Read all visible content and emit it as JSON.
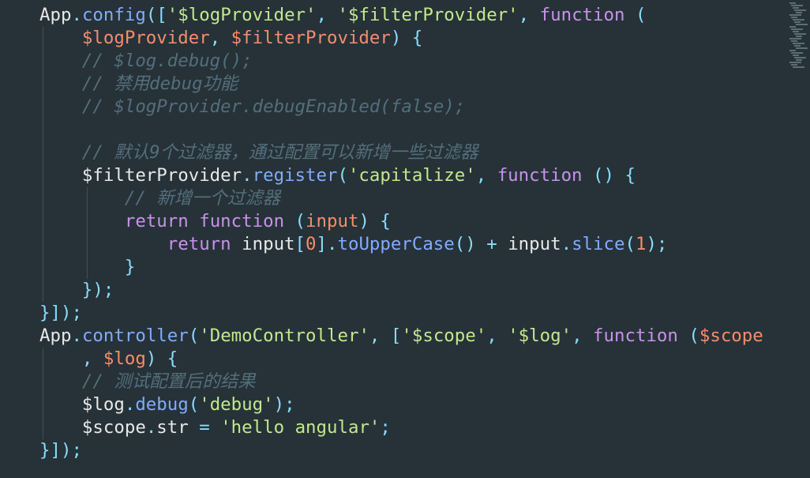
{
  "code": {
    "lines": [
      [
        {
          "t": "App",
          "c": "id"
        },
        {
          "t": ".",
          "c": "punc"
        },
        {
          "t": "config",
          "c": "prop"
        },
        {
          "t": "([",
          "c": "punc"
        },
        {
          "t": "'$logProvider'",
          "c": "str"
        },
        {
          "t": ", ",
          "c": "punc"
        },
        {
          "t": "'$filterProvider'",
          "c": "str"
        },
        {
          "t": ", ",
          "c": "punc"
        },
        {
          "t": "function",
          "c": "kw"
        },
        {
          "t": " (",
          "c": "punc"
        }
      ],
      [
        {
          "t": "    ",
          "c": "id"
        },
        {
          "t": "$logProvider",
          "c": "var"
        },
        {
          "t": ", ",
          "c": "punc"
        },
        {
          "t": "$filterProvider",
          "c": "var"
        },
        {
          "t": ") {",
          "c": "punc"
        }
      ],
      [
        {
          "t": "    ",
          "c": "id"
        },
        {
          "t": "// $log.debug();",
          "c": "com"
        }
      ],
      [
        {
          "t": "    ",
          "c": "id"
        },
        {
          "t": "// 禁用debug功能",
          "c": "com"
        }
      ],
      [
        {
          "t": "    ",
          "c": "id"
        },
        {
          "t": "// $logProvider.debugEnabled(false);",
          "c": "com"
        }
      ],
      [
        {
          "t": "",
          "c": "id"
        }
      ],
      [
        {
          "t": "    ",
          "c": "id"
        },
        {
          "t": "// 默认9个过滤器，通过配置可以新增一些过滤器",
          "c": "com"
        }
      ],
      [
        {
          "t": "    ",
          "c": "id"
        },
        {
          "t": "$filterProvider",
          "c": "id"
        },
        {
          "t": ".",
          "c": "punc"
        },
        {
          "t": "register",
          "c": "prop"
        },
        {
          "t": "(",
          "c": "punc"
        },
        {
          "t": "'capitalize'",
          "c": "str"
        },
        {
          "t": ", ",
          "c": "punc"
        },
        {
          "t": "function",
          "c": "kw"
        },
        {
          "t": " () {",
          "c": "punc"
        }
      ],
      [
        {
          "t": "        ",
          "c": "id"
        },
        {
          "t": "// 新增一个过滤器",
          "c": "com"
        }
      ],
      [
        {
          "t": "        ",
          "c": "id"
        },
        {
          "t": "return",
          "c": "kw"
        },
        {
          "t": " ",
          "c": "id"
        },
        {
          "t": "function",
          "c": "kw"
        },
        {
          "t": " (",
          "c": "punc"
        },
        {
          "t": "input",
          "c": "var"
        },
        {
          "t": ") {",
          "c": "punc"
        }
      ],
      [
        {
          "t": "            ",
          "c": "id"
        },
        {
          "t": "return",
          "c": "kw"
        },
        {
          "t": " input",
          "c": "id"
        },
        {
          "t": "[",
          "c": "punc"
        },
        {
          "t": "0",
          "c": "num"
        },
        {
          "t": "].",
          "c": "punc"
        },
        {
          "t": "toUpperCase",
          "c": "prop"
        },
        {
          "t": "() + ",
          "c": "punc"
        },
        {
          "t": "input",
          "c": "id"
        },
        {
          "t": ".",
          "c": "punc"
        },
        {
          "t": "slice",
          "c": "prop"
        },
        {
          "t": "(",
          "c": "punc"
        },
        {
          "t": "1",
          "c": "num"
        },
        {
          "t": ");",
          "c": "punc"
        }
      ],
      [
        {
          "t": "        ",
          "c": "id"
        },
        {
          "t": "}",
          "c": "punc"
        }
      ],
      [
        {
          "t": "    ",
          "c": "id"
        },
        {
          "t": "});",
          "c": "punc"
        }
      ],
      [
        {
          "t": "}]);",
          "c": "punc"
        }
      ],
      [
        {
          "t": "App",
          "c": "id"
        },
        {
          "t": ".",
          "c": "punc"
        },
        {
          "t": "controller",
          "c": "prop"
        },
        {
          "t": "(",
          "c": "punc"
        },
        {
          "t": "'DemoController'",
          "c": "str"
        },
        {
          "t": ", [",
          "c": "punc"
        },
        {
          "t": "'$scope'",
          "c": "str"
        },
        {
          "t": ", ",
          "c": "punc"
        },
        {
          "t": "'$log'",
          "c": "str"
        },
        {
          "t": ", ",
          "c": "punc"
        },
        {
          "t": "function",
          "c": "kw"
        },
        {
          "t": " (",
          "c": "punc"
        },
        {
          "t": "$scope",
          "c": "var"
        }
      ],
      [
        {
          "t": "    ",
          "c": "id"
        },
        {
          "t": ", ",
          "c": "punc"
        },
        {
          "t": "$log",
          "c": "var"
        },
        {
          "t": ") {",
          "c": "punc"
        }
      ],
      [
        {
          "t": "    ",
          "c": "id"
        },
        {
          "t": "// 测试配置后的结果",
          "c": "com"
        }
      ],
      [
        {
          "t": "    ",
          "c": "id"
        },
        {
          "t": "$log",
          "c": "id"
        },
        {
          "t": ".",
          "c": "punc"
        },
        {
          "t": "debug",
          "c": "prop"
        },
        {
          "t": "(",
          "c": "punc"
        },
        {
          "t": "'debug'",
          "c": "str"
        },
        {
          "t": ");",
          "c": "punc"
        }
      ],
      [
        {
          "t": "    ",
          "c": "id"
        },
        {
          "t": "$scope",
          "c": "id"
        },
        {
          "t": ".",
          "c": "punc"
        },
        {
          "t": "str",
          "c": "id"
        },
        {
          "t": " = ",
          "c": "punc"
        },
        {
          "t": "'hello angular'",
          "c": "str"
        },
        {
          "t": ";",
          "c": "punc"
        }
      ],
      [
        {
          "t": "}]);",
          "c": "punc"
        }
      ]
    ]
  },
  "theme": {
    "background": "#263238",
    "keyword": "#c792ea",
    "string": "#c3e88d",
    "property": "#82aaff",
    "variable": "#f78c6c",
    "comment": "#546e7a"
  }
}
